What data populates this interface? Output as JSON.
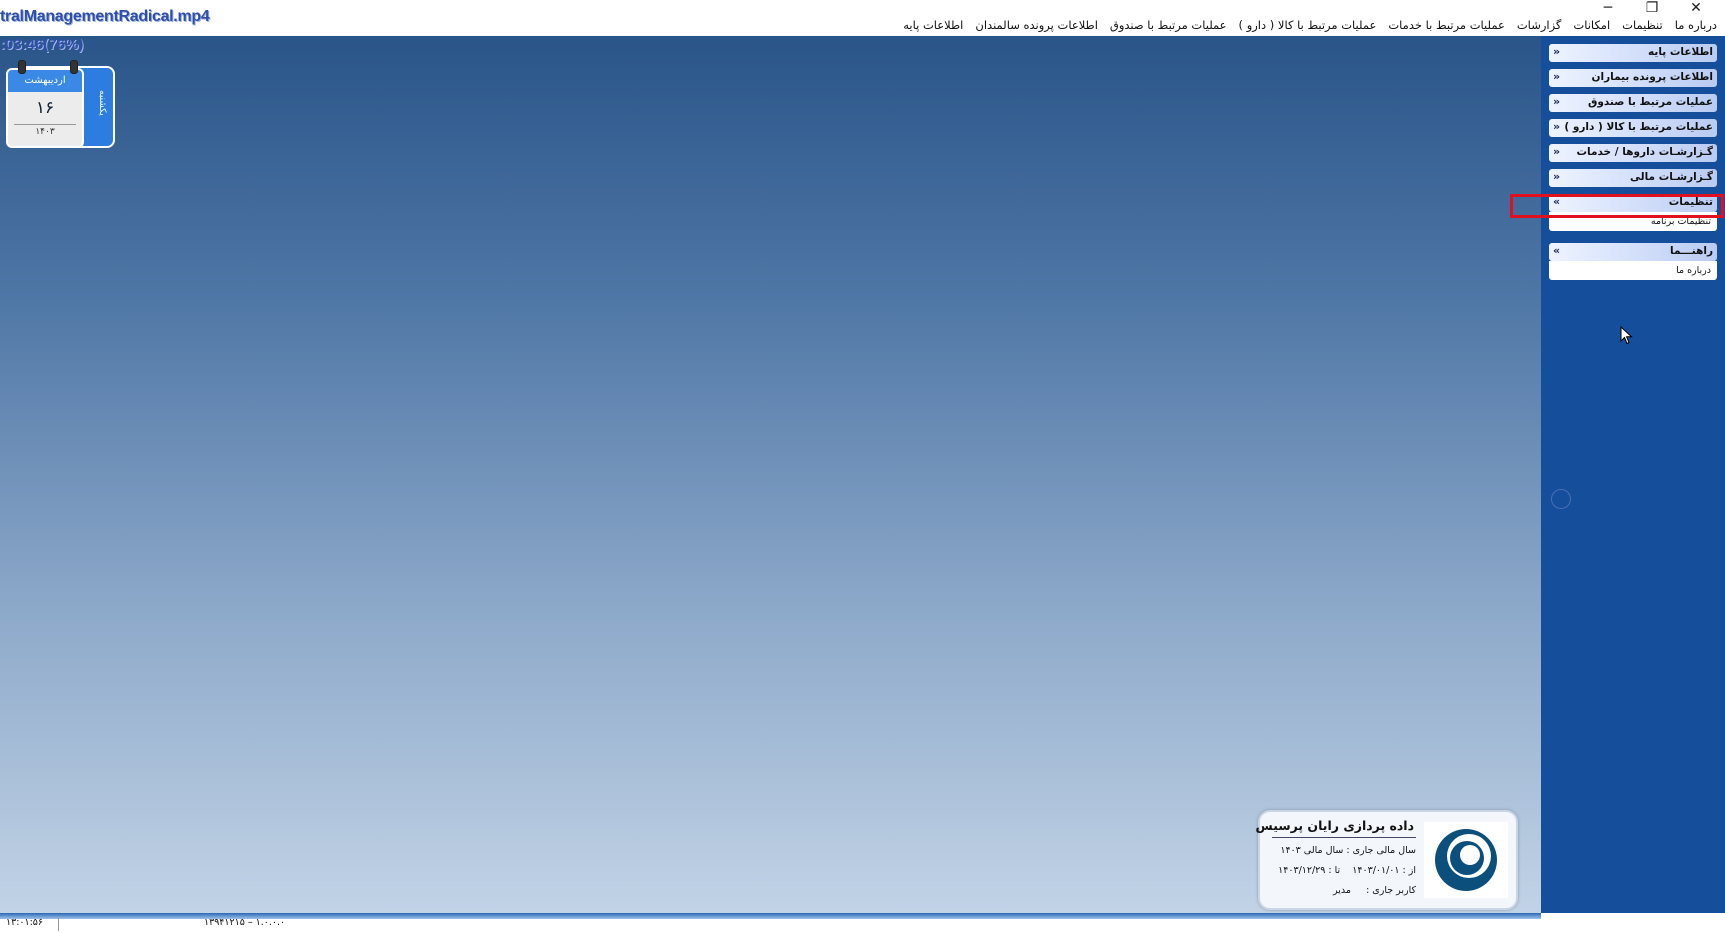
{
  "window": {
    "video_title": "tralManagementRadical.mp4",
    "minimize": "─",
    "restore": "❐",
    "close": "✕"
  },
  "overlay": {
    "timer": ":03:46(76%)"
  },
  "menubar": {
    "items": [
      "اطلاعات پایه",
      "اطلاعات پرونده سالمندان",
      "عملیات مرتبط با صندوق",
      "عملیات مرتبط با کالا ( دارو )",
      "عملیات مرتبط با خدمات",
      "گزارشات",
      "امکانات",
      "تنظیمات",
      "درباره ما"
    ]
  },
  "calendar": {
    "month": "اردیبهشت",
    "day": "۱۶",
    "year": "۱۴۰۳",
    "weekday": "یکشنبه"
  },
  "sidebar": {
    "collapsed": [
      "اطلاعات پایه",
      "اطلاعات پرونده بیماران",
      "عملیات مرتبط با صندوق",
      "عملیات مرتبط با کالا ( دارو )",
      "گـزارشـات داروها / خدمات",
      "گـزارشـات مالی"
    ],
    "settings": {
      "label": "تنظیمات",
      "sub": "تنظیمات برنامه"
    },
    "help": {
      "label": "راهنـــما",
      "sub": "درباره ما"
    }
  },
  "info": {
    "company": "داده پردازی رایان پرسیس",
    "fiscal_label": "سال مالی جاری  :",
    "fiscal_value": "سال مالی ۱۴۰۳",
    "from_label": "از :",
    "from_value": "۱۴۰۳/۰۱/۰۱",
    "to_label": "تا :",
    "to_value": "۱۴۰۳/۱۲/۲۹",
    "user_label": "کاربر جاری :",
    "user_value": "مدیر"
  },
  "status": {
    "time": "۱۳:۰۱:۵۶",
    "version": "۱۳۹۴۱۲۱۵ – ۱.۰.۰.۰"
  },
  "colors": {
    "sidebar": "#154e9b",
    "highlight": "#e0101e"
  }
}
